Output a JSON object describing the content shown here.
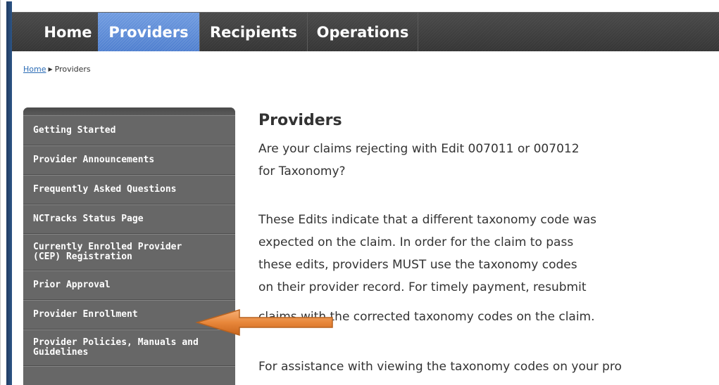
{
  "topnav": {
    "items": [
      {
        "label": "Home",
        "active": false
      },
      {
        "label": "Providers",
        "active": true
      },
      {
        "label": "Recipients",
        "active": false
      },
      {
        "label": "Operations",
        "active": false
      }
    ]
  },
  "breadcrumb": {
    "home": "Home",
    "current": "Providers"
  },
  "sidebar": {
    "items": [
      {
        "label_line1": "Getting Started",
        "label_line2": ""
      },
      {
        "label_line1": "Provider Announcements",
        "label_line2": ""
      },
      {
        "label_line1": "Frequently Asked Questions",
        "label_line2": ""
      },
      {
        "label_line1": "NCTracks Status Page",
        "label_line2": ""
      },
      {
        "label_line1": "Currently Enrolled Provider",
        "label_line2": "(CEP) Registration"
      },
      {
        "label_line1": "Prior Approval",
        "label_line2": ""
      },
      {
        "label_line1": "Provider Enrollment",
        "label_line2": ""
      },
      {
        "label_line1": "Provider Policies, Manuals and",
        "label_line2": "Guidelines"
      }
    ]
  },
  "main": {
    "title": "Providers",
    "paragraph1": [
      "Are your claims rejecting with Edit 007011 or 007012",
      "for Taxonomy?"
    ],
    "paragraph2": [
      "These Edits indicate that a different taxonomy code was",
      "expected on the claim. In order for the claim to pass",
      "these edits, providers MUST use the taxonomy codes",
      "on their provider record. For timely payment, resubmit",
      "claims with the corrected taxonomy codes on the claim."
    ],
    "paragraph3": [
      "For assistance with viewing the taxonomy codes on your pro"
    ]
  },
  "annotation": {
    "arrow_color": "#e8873a",
    "arrow_target": "Provider Enrollment"
  }
}
